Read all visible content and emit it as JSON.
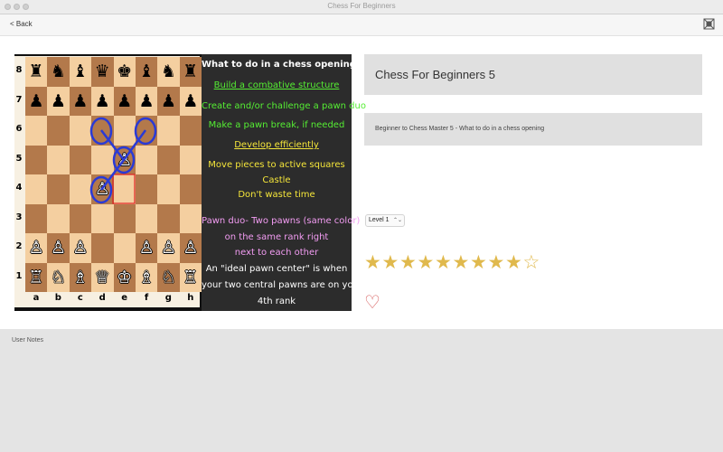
{
  "window": {
    "title": "Chess For Beginners"
  },
  "toolbar": {
    "back_label": "< Back",
    "fullscreen_icon": "fullscreen-icon"
  },
  "lesson": {
    "title": "Chess For Beginners 5",
    "description": "Beginner to Chess Master 5 - What to do in a chess opening",
    "level": "Level 1",
    "rating": 9,
    "rating_max": 10,
    "favorite_icon": "heart-icon"
  },
  "video": {
    "board": {
      "ranks": [
        "8",
        "7",
        "6",
        "5",
        "4",
        "3",
        "2",
        "1"
      ],
      "files": [
        "a",
        "b",
        "c",
        "d",
        "e",
        "f",
        "g",
        "h"
      ],
      "rows": [
        [
          "♜",
          "♞",
          "♝",
          "♛",
          "♚",
          "♝",
          "♞",
          "♜"
        ],
        [
          "♟",
          "♟",
          "♟",
          "♟",
          "♟",
          "♟",
          "♟",
          "♟"
        ],
        [
          "",
          "",
          "",
          "",
          "",
          "",
          "",
          ""
        ],
        [
          "",
          "",
          "",
          "",
          "♙",
          "",
          "",
          ""
        ],
        [
          "",
          "",
          "",
          "♙",
          "",
          "",
          "",
          ""
        ],
        [
          "",
          "",
          "",
          "",
          "",
          "",
          "",
          ""
        ],
        [
          "♙",
          "♙",
          "♙",
          "",
          "",
          "♙",
          "♙",
          "♙"
        ],
        [
          "♖",
          "♘",
          "♗",
          "♕",
          "♔",
          "♗",
          "♘",
          "♖"
        ]
      ]
    },
    "chalkboard": [
      {
        "text": "What to do in a chess opening?",
        "color": "#ffffff",
        "underline": false
      },
      {
        "text": "Build a combative structure",
        "color": "#55ee33",
        "underline": true
      },
      {
        "text": "Create and/or challenge a pawn duo",
        "color": "#55ee33",
        "underline": false
      },
      {
        "text": "Make a pawn break, if needed",
        "color": "#55ee33",
        "underline": false
      },
      {
        "text": "Develop efficiently",
        "color": "#f5e63a",
        "underline": true
      },
      {
        "text": "Move pieces to active squares",
        "color": "#f5e63a",
        "underline": false
      },
      {
        "text": "Castle",
        "color": "#f5e63a",
        "underline": false
      },
      {
        "text": "Don't waste time",
        "color": "#f5e63a",
        "underline": false
      },
      {
        "text": "Pawn duo- Two pawns (same color)",
        "color": "#f29cf2",
        "underline": false
      },
      {
        "text": "on the same rank right",
        "color": "#f29cf2",
        "underline": false
      },
      {
        "text": "next to each other",
        "color": "#f29cf2",
        "underline": false
      },
      {
        "text": "An \"ideal pawn center\" is when",
        "color": "#ffffff",
        "underline": false
      },
      {
        "text": "your two central pawns are on your",
        "color": "#ffffff",
        "underline": false
      },
      {
        "text": "4th rank",
        "color": "#ffffff",
        "underline": false
      }
    ]
  },
  "notes": {
    "label": "User Notes",
    "value": ""
  },
  "colors": {
    "star": "#e0b94d",
    "heart": "#d65a5a",
    "panel": "#e0e0e0"
  }
}
